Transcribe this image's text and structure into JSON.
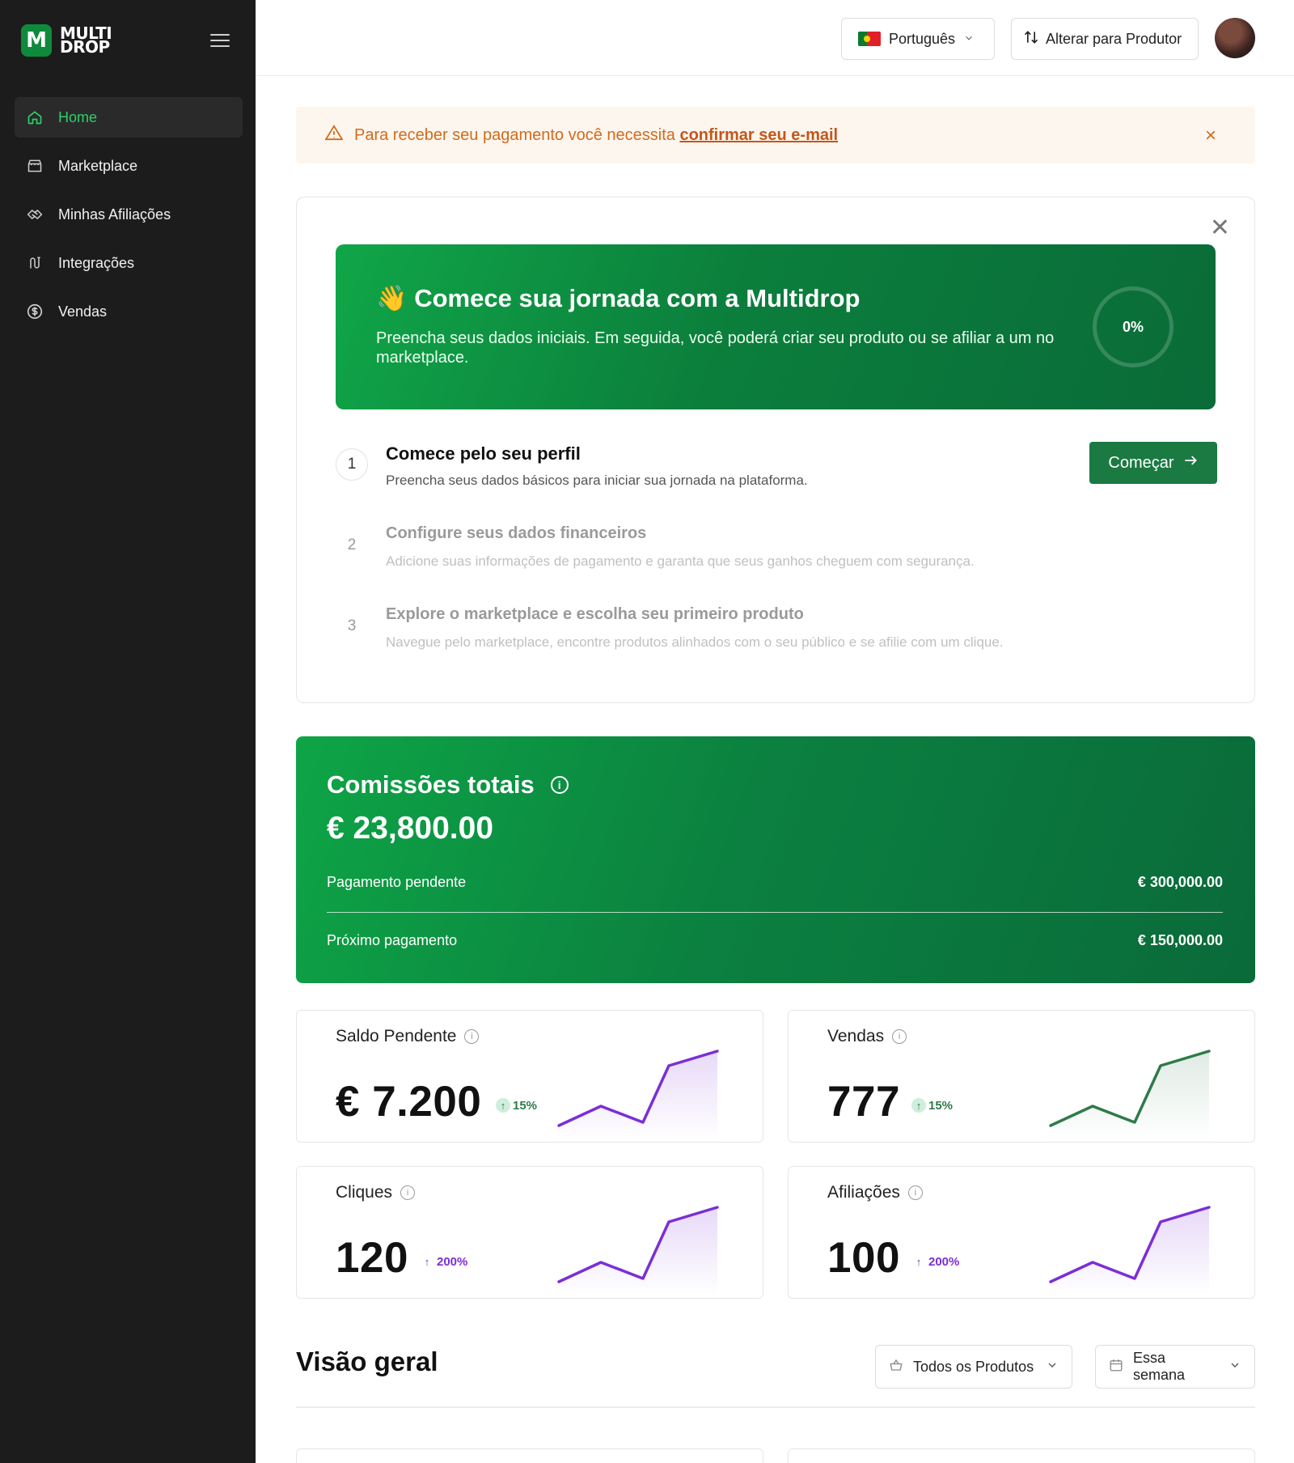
{
  "brand": {
    "line1": "MULTI",
    "line2": "DROP",
    "mark": "M"
  },
  "sidebar": {
    "items": [
      {
        "label": "Home",
        "icon": "home-icon",
        "active": true
      },
      {
        "label": "Marketplace",
        "icon": "store-icon",
        "active": false
      },
      {
        "label": "Minhas Afiliações",
        "icon": "handshake-icon",
        "active": false
      },
      {
        "label": "Integrações",
        "icon": "plug-icon",
        "active": false
      },
      {
        "label": "Vendas",
        "icon": "dollar-icon",
        "active": false
      }
    ]
  },
  "topbar": {
    "language": "Português",
    "switch_label": "Alterar para Produtor"
  },
  "alert": {
    "text": "Para receber seu pagamento você necessita",
    "link": "confirmar seu e-mail"
  },
  "onboarding": {
    "title": "Comece sua jornada com a Multidrop",
    "title_emoji": "👋",
    "subtitle": "Preencha seus dados iniciais. Em seguida, você poderá criar seu produto ou se afiliar a um no marketplace.",
    "progress": "0%",
    "steps": [
      {
        "num": "1",
        "title": "Comece pelo seu perfil",
        "desc": "Preencha seus dados básicos para iniciar sua jornada na plataforma."
      },
      {
        "num": "2",
        "title": "Configure seus dados financeiros",
        "desc": "Adicione suas informações de pagamento e garanta que seus ganhos cheguem com segurança."
      },
      {
        "num": "3",
        "title": "Explore o marketplace e escolha seu primeiro produto",
        "desc": "Navegue pelo marketplace, encontre produtos alinhados com o seu público e se afilie com um clique."
      }
    ],
    "start_label": "Começar"
  },
  "commissions": {
    "title": "Comissões totais",
    "value": "€ 23,800.00",
    "pending_label": "Pagamento pendente",
    "pending_value": "€ 300,000.00",
    "next_label": "Próximo pagamento",
    "next_value": "€ 150,000.00"
  },
  "stats": [
    {
      "title": "Saldo Pendente",
      "value": "€ 7.200",
      "change": "15%",
      "color": "#7b2fd6"
    },
    {
      "title": "Vendas",
      "value": "777",
      "change": "15%",
      "color": "#2f7a4a"
    },
    {
      "title": "Cliques",
      "value": "120",
      "change": "200%",
      "color": "#7b2fd6"
    },
    {
      "title": "Afiliações",
      "value": "100",
      "change": "200%",
      "color": "#7b2fd6"
    }
  ],
  "overview": {
    "title": "Visão geral",
    "products_filter": "Todos os Produtos",
    "period_filter": "Essa semana"
  },
  "colors": {
    "brand_green": "#0b8140",
    "sidebar_bg": "#1c1c1c",
    "active_nav": "#2fcf6b",
    "alert_text": "#d46a1c",
    "purple": "#7b2fd6"
  }
}
